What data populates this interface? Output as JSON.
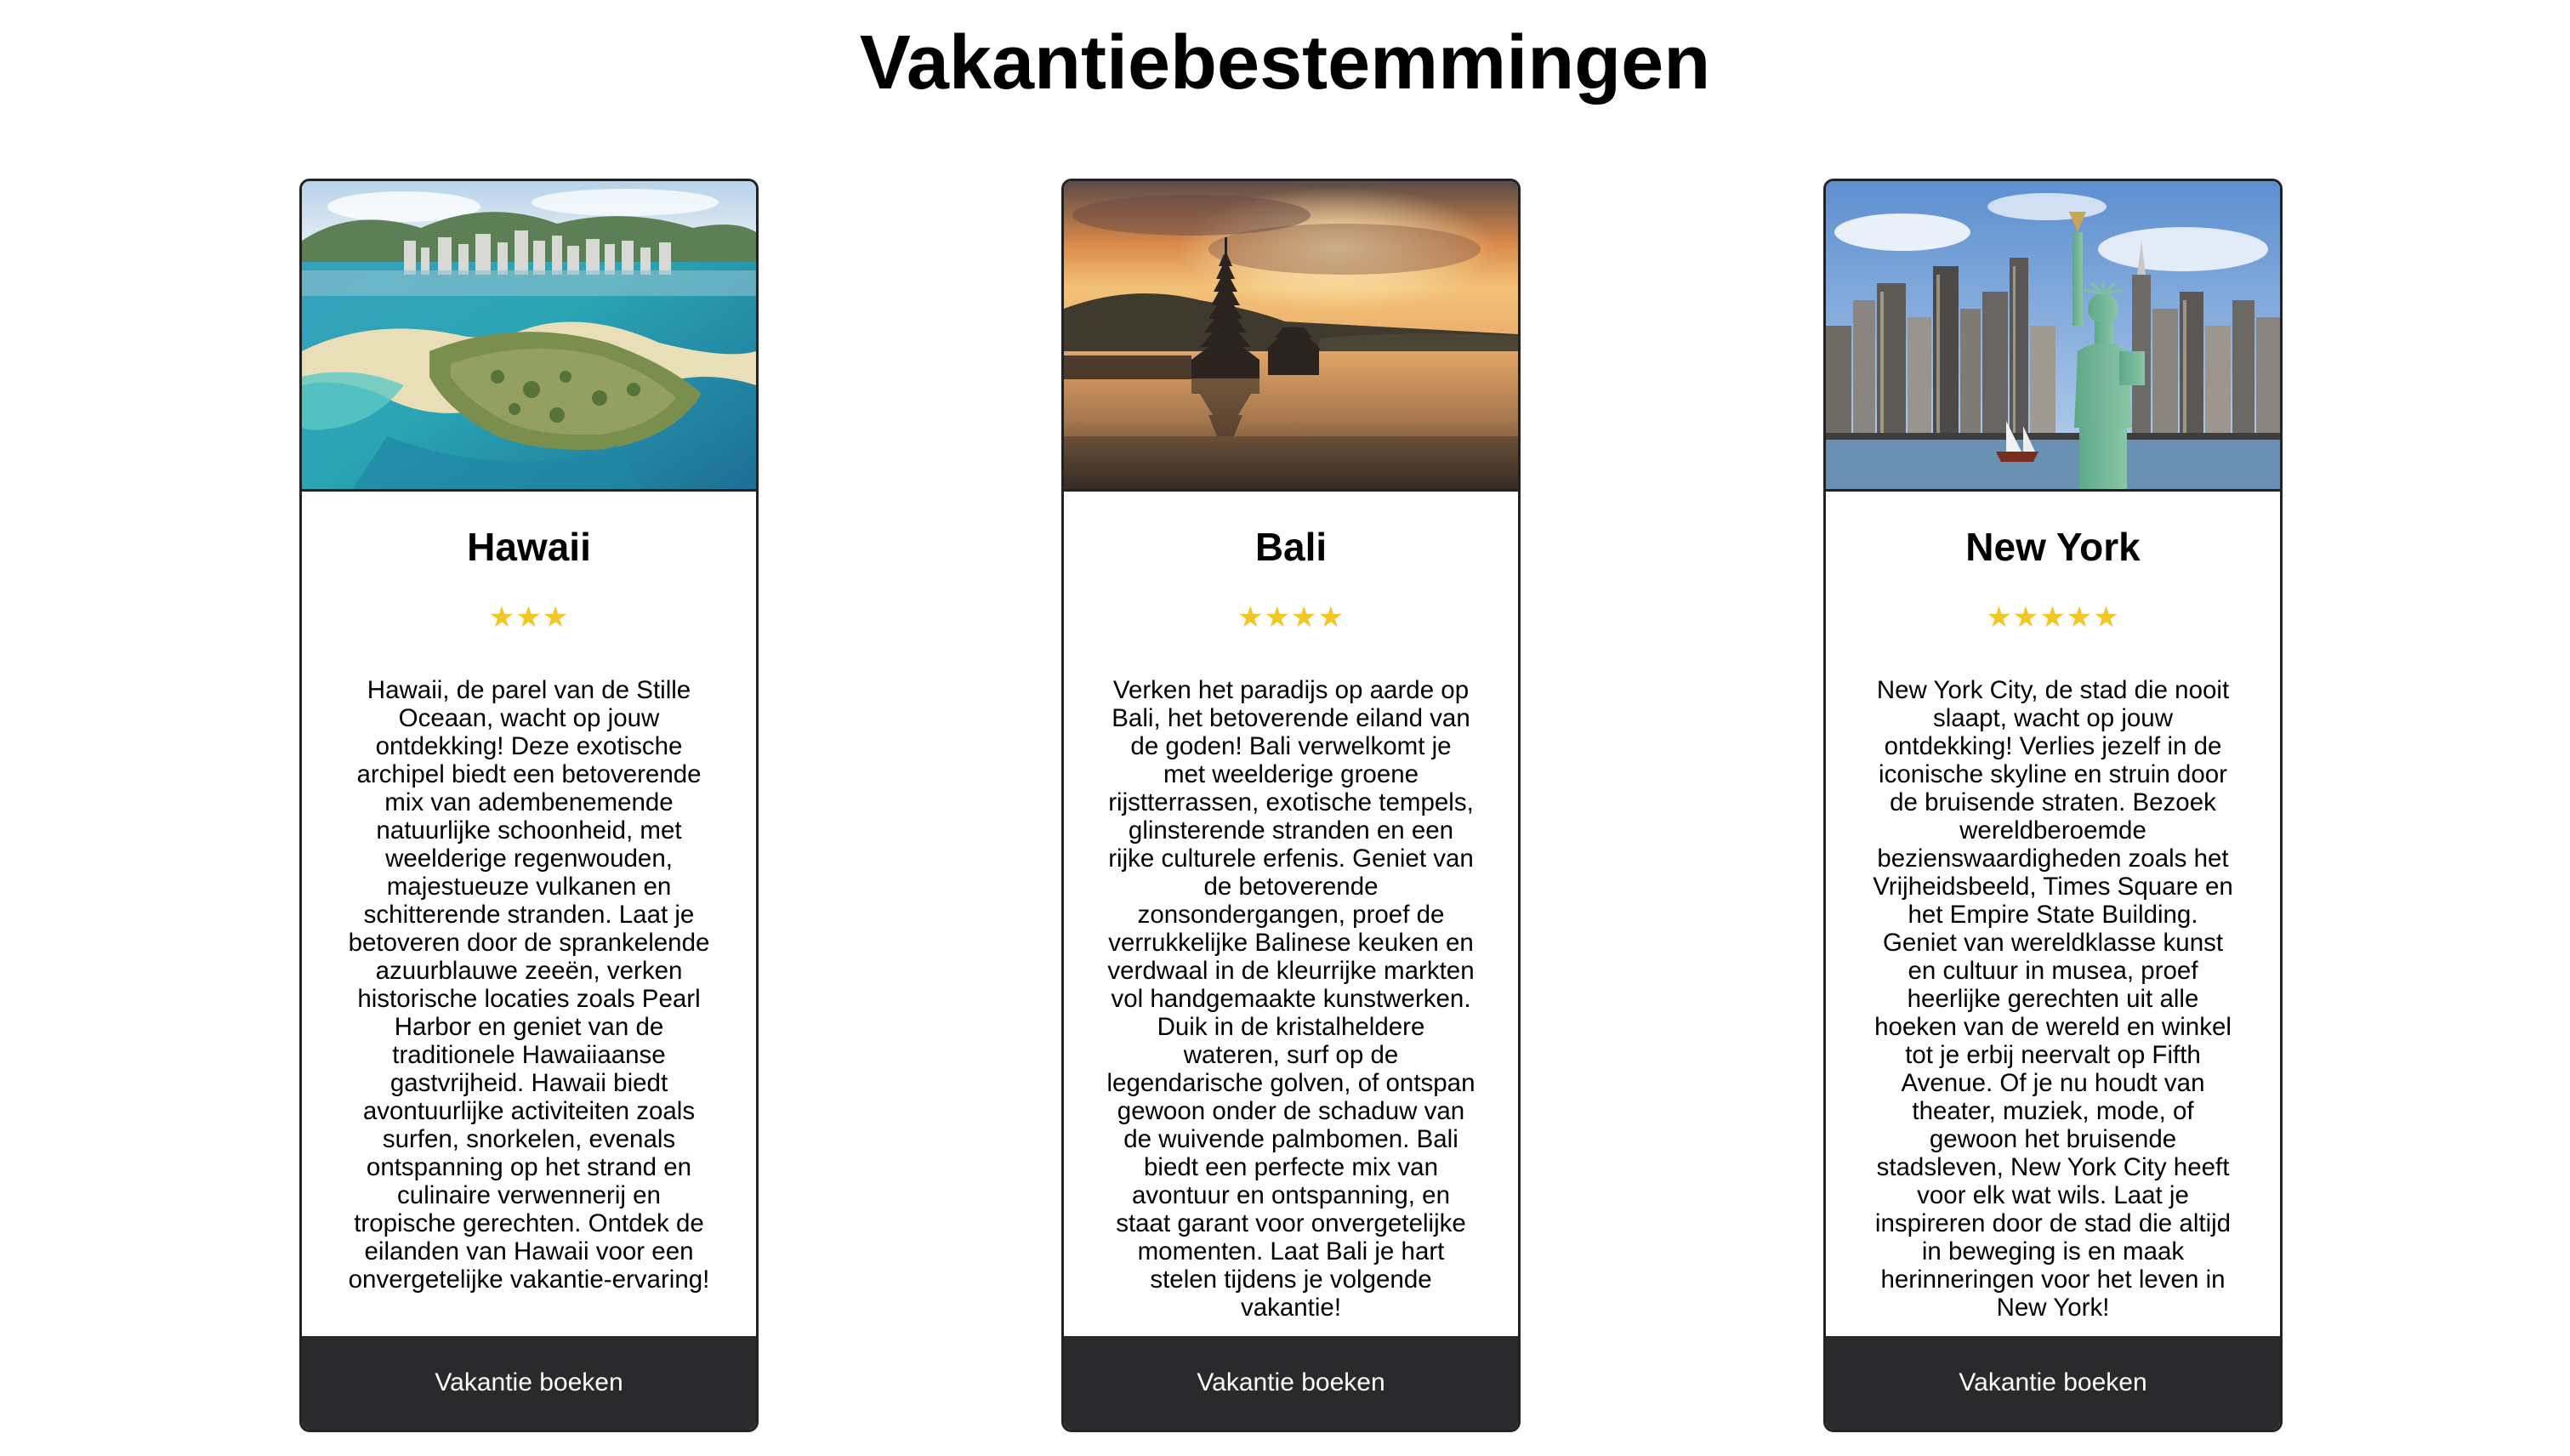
{
  "page": {
    "title": "Vakantiebestemmingen"
  },
  "colors": {
    "star": "#f3c623",
    "button_background": "#2a2a2c",
    "card_border": "#222222"
  },
  "destinations": [
    {
      "name": "Hawaii",
      "rating": 3,
      "stars": "★★★",
      "image": "hawaii-coastline-photo",
      "description": "Hawaii, de parel van de Stille Oceaan, wacht op jouw ontdekking! Deze exotische archipel biedt een betoverende mix van adembenemende natuurlijke schoonheid, met weelderige regenwouden, majestueuze vulkanen en schitterende stranden. Laat je betoveren door de sprankelende azuurblauwe zeeën, verken historische locaties zoals Pearl Harbor en geniet van de traditionele Hawaiiaanse gastvrijheid. Hawaii biedt avontuurlijke activiteiten zoals surfen, snorkelen, evenals ontspanning op het strand en culinaire verwennerij en tropische gerechten. Ontdek de eilanden van Hawaii voor een onvergetelijke vakantie-ervaring!",
      "button_label": "Vakantie boeken"
    },
    {
      "name": "Bali",
      "rating": 4,
      "stars": "★★★★",
      "image": "bali-temple-sunset-photo",
      "description": "Verken het paradijs op aarde op Bali, het betoverende eiland van de goden! Bali verwelkomt je met weelderige groene rijstterrassen, exotische tempels, glinsterende stranden en een rijke culturele erfenis. Geniet van de betoverende zonsondergangen, proef de verrukkelijke Balinese keuken en verdwaal in de kleurrijke markten vol handgemaakte kunstwerken. Duik in de kristalheldere wateren, surf op de legendarische golven, of ontspan gewoon onder de schaduw van de wuivende palmbomen. Bali biedt een perfecte mix van avontuur en ontspanning, en staat garant voor onvergetelijke momenten. Laat Bali je hart stelen tijdens je volgende vakantie!",
      "button_label": "Vakantie boeken"
    },
    {
      "name": "New York",
      "rating": 5,
      "stars": "★★★★★",
      "image": "new-york-skyline-statue-of-liberty-photo",
      "description": "New York City, de stad die nooit slaapt, wacht op jouw ontdekking! Verlies jezelf in de iconische skyline en struin door de bruisende straten. Bezoek wereldberoemde bezienswaardigheden zoals het Vrijheidsbeeld, Times Square en het Empire State Building. Geniet van wereldklasse kunst en cultuur in musea, proef heerlijke gerechten uit alle hoeken van de wereld en winkel tot je erbij neervalt op Fifth Avenue. Of je nu houdt van theater, muziek, mode, of gewoon het bruisende stadsleven, New York City heeft voor elk wat wils. Laat je inspireren door de stad die altijd in beweging is en maak herinneringen voor het leven in New York!",
      "button_label": "Vakantie boeken"
    }
  ]
}
